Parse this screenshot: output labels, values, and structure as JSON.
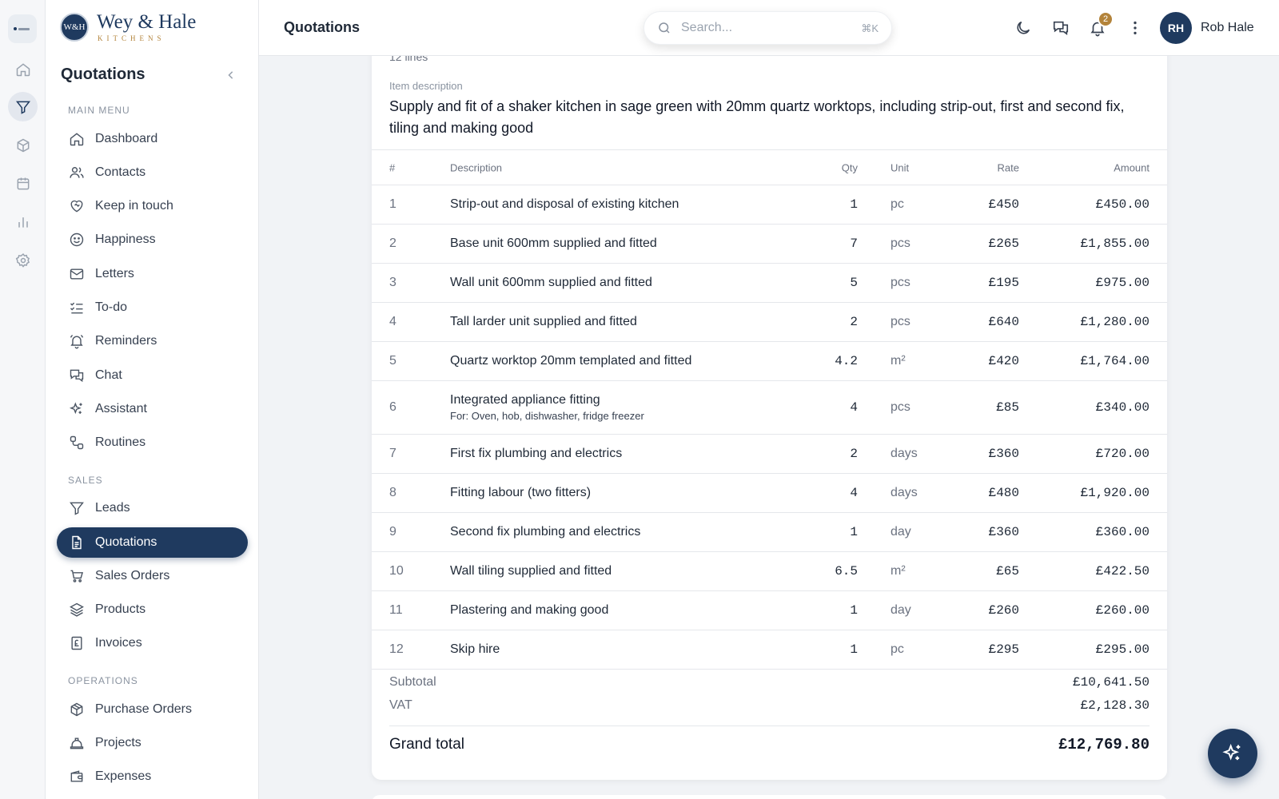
{
  "brand": {
    "mark": "W&H",
    "name": "Wey & Hale",
    "sub": "KITCHENS"
  },
  "sidebar": {
    "title": "Quotations",
    "sections": {
      "main": "MAIN MENU",
      "sales": "SALES",
      "operations": "OPERATIONS"
    },
    "items": [
      {
        "label": "Dashboard",
        "icon": "home-icon"
      },
      {
        "label": "Contacts",
        "icon": "users-icon"
      },
      {
        "label": "Keep in touch",
        "icon": "heart-handshake-icon"
      },
      {
        "label": "Happiness",
        "icon": "smile-icon"
      },
      {
        "label": "Letters",
        "icon": "mail-icon"
      },
      {
        "label": "To-do",
        "icon": "checklist-icon"
      },
      {
        "label": "Reminders",
        "icon": "bell-ring-icon"
      },
      {
        "label": "Chat",
        "icon": "chat-icon"
      },
      {
        "label": "Assistant",
        "icon": "sparkles-icon"
      },
      {
        "label": "Routines",
        "icon": "routine-icon"
      },
      {
        "label": "Leads",
        "icon": "funnel-icon"
      },
      {
        "label": "Quotations",
        "icon": "file-text-icon",
        "active": true
      },
      {
        "label": "Sales Orders",
        "icon": "cart-icon"
      },
      {
        "label": "Products",
        "icon": "layers-icon"
      },
      {
        "label": "Invoices",
        "icon": "pound-receipt-icon"
      },
      {
        "label": "Purchase Orders",
        "icon": "package-icon"
      },
      {
        "label": "Projects",
        "icon": "hard-hat-icon"
      },
      {
        "label": "Expenses",
        "icon": "wallet-icon"
      }
    ]
  },
  "topbar": {
    "title": "Quotations",
    "search_placeholder": "Search...",
    "search_shortcut": "⌘K",
    "notifications": "2",
    "user_initials": "RH",
    "user_name": "Rob Hale"
  },
  "quote": {
    "lines_count": "12 lines",
    "desc_label": "Item description",
    "description": "Supply and fit of a shaker kitchen in sage green with 20mm quartz worktops, including strip-out, first and second fix, tiling and making good",
    "columns": {
      "num": "#",
      "desc": "Description",
      "qty": "Qty",
      "unit": "Unit",
      "rate": "Rate",
      "amount": "Amount"
    },
    "lines": [
      {
        "num": "1",
        "desc": "Strip-out and disposal of existing kitchen",
        "qty": "1",
        "unit": "pc",
        "rate": "£450",
        "amount": "£450.00"
      },
      {
        "num": "2",
        "desc": "Base unit 600mm supplied and fitted",
        "qty": "7",
        "unit": "pcs",
        "rate": "£265",
        "amount": "£1,855.00"
      },
      {
        "num": "3",
        "desc": "Wall unit 600mm supplied and fitted",
        "qty": "5",
        "unit": "pcs",
        "rate": "£195",
        "amount": "£975.00"
      },
      {
        "num": "4",
        "desc": "Tall larder unit supplied and fitted",
        "qty": "2",
        "unit": "pcs",
        "rate": "£640",
        "amount": "£1,280.00"
      },
      {
        "num": "5",
        "desc": "Quartz worktop 20mm templated and fitted",
        "qty": "4.2",
        "unit": "m²",
        "rate": "£420",
        "amount": "£1,764.00"
      },
      {
        "num": "6",
        "desc": "Integrated appliance fitting",
        "sub": "For: Oven, hob, dishwasher, fridge freezer",
        "qty": "4",
        "unit": "pcs",
        "rate": "£85",
        "amount": "£340.00"
      },
      {
        "num": "7",
        "desc": "First fix plumbing and electrics",
        "qty": "2",
        "unit": "days",
        "rate": "£360",
        "amount": "£720.00"
      },
      {
        "num": "8",
        "desc": "Fitting labour (two fitters)",
        "qty": "4",
        "unit": "days",
        "rate": "£480",
        "amount": "£1,920.00"
      },
      {
        "num": "9",
        "desc": "Second fix plumbing and electrics",
        "qty": "1",
        "unit": "day",
        "rate": "£360",
        "amount": "£360.00"
      },
      {
        "num": "10",
        "desc": "Wall tiling supplied and fitted",
        "qty": "6.5",
        "unit": "m²",
        "rate": "£65",
        "amount": "£422.50"
      },
      {
        "num": "11",
        "desc": "Plastering and making good",
        "qty": "1",
        "unit": "day",
        "rate": "£260",
        "amount": "£260.00"
      },
      {
        "num": "12",
        "desc": "Skip hire",
        "qty": "1",
        "unit": "pc",
        "rate": "£295",
        "amount": "£295.00"
      }
    ],
    "subtotal_label": "Subtotal",
    "subtotal": "£10,641.50",
    "vat_label": "VAT",
    "vat": "£2,128.30",
    "grand_label": "Grand total",
    "grand": "£12,769.80"
  },
  "colors": {
    "primary": "#1f3a5f",
    "accent": "#b3833a"
  }
}
